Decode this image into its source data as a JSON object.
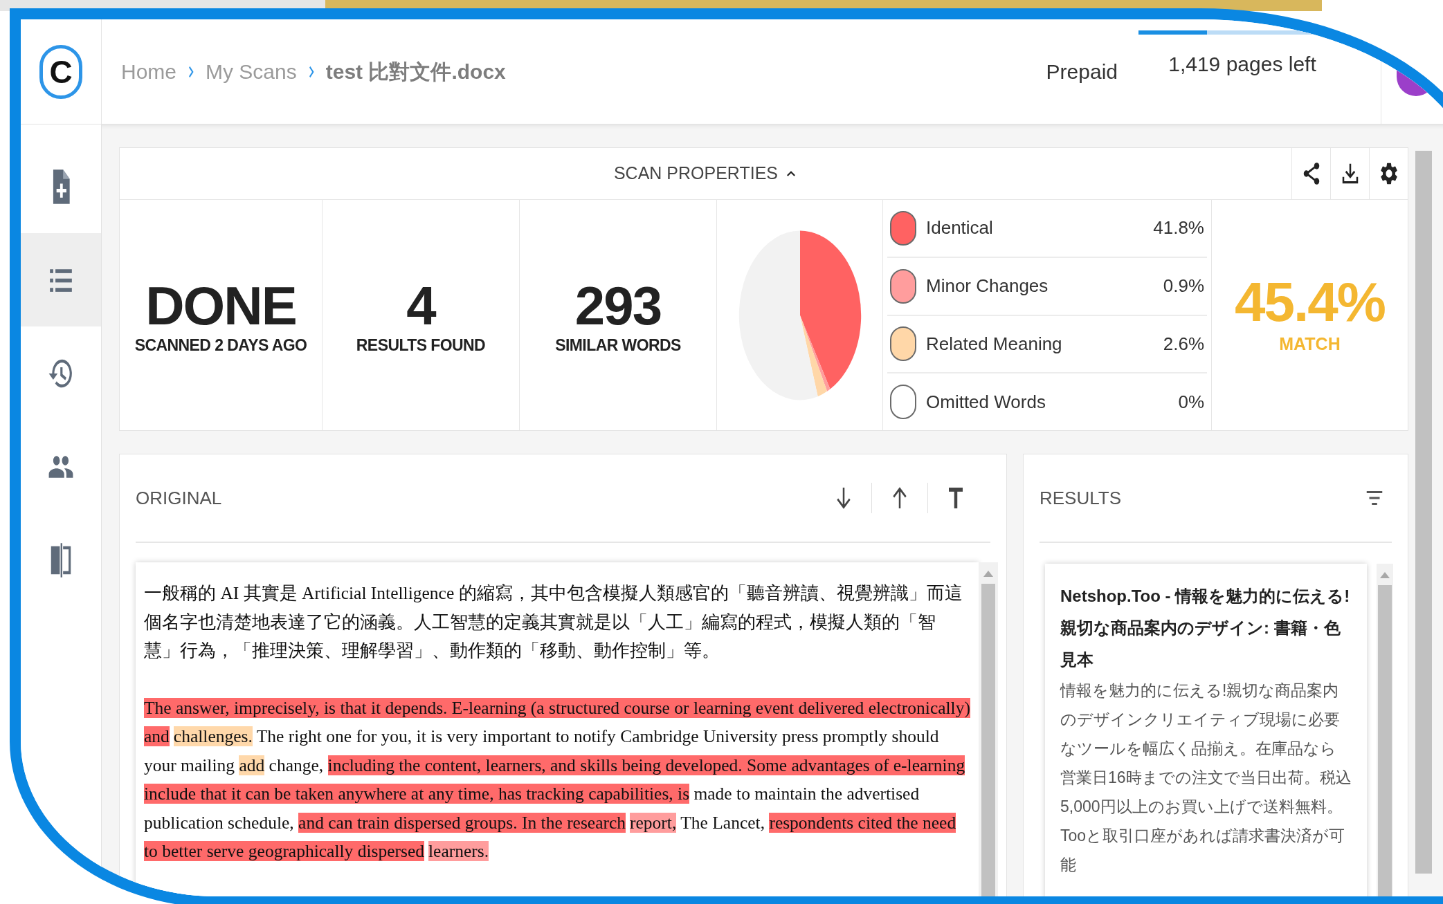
{
  "header": {
    "logo": "C",
    "breadcrumb": [
      {
        "label": "Home",
        "current": false
      },
      {
        "label": "My Scans",
        "current": false
      },
      {
        "label": "test 比對文件.docx",
        "current": true
      }
    ],
    "plan": "Prepaid",
    "pages_left": "1,419 pages left",
    "usage": {
      "level": 0.33
    }
  },
  "sidebar": {
    "items": [
      {
        "kind": "new-scan",
        "selected": false
      },
      {
        "kind": "list",
        "selected": true
      },
      {
        "kind": "history",
        "selected": false
      },
      {
        "kind": "users",
        "selected": false
      },
      {
        "kind": "compare",
        "selected": false
      }
    ]
  },
  "scan_properties": {
    "title": "SCAN PROPERTIES",
    "expanded": true,
    "actions": [
      {
        "kind": "share"
      },
      {
        "kind": "download"
      },
      {
        "kind": "settings"
      }
    ],
    "stats": [
      {
        "value": "DONE",
        "label": "SCANNED 2 DAYS AGO"
      },
      {
        "value": "4",
        "label": "RESULTS FOUND"
      },
      {
        "value": "293",
        "label": "SIMILAR WORDS"
      }
    ],
    "chart_data": {
      "type": "pie",
      "categories": [
        "Identical",
        "Minor Changes",
        "Related Meaning",
        "Omitted Words",
        null
      ],
      "values": [
        41.8,
        0.9,
        2.6,
        0,
        54.7
      ]
    },
    "legend": [
      {
        "percent": "41.8%",
        "color": "#ff6262"
      },
      {
        "percent": "0.9%",
        "color": "#ff9d9d"
      },
      {
        "percent": "2.6%",
        "color": "#ffd7a8"
      },
      {
        "percent": "0%",
        "color": "#ffffff"
      }
    ],
    "match": {
      "value": "45.4%",
      "label": "MATCH"
    }
  },
  "original": {
    "title": "ORIGINAL",
    "tools": [
      {
        "kind": "next"
      },
      {
        "kind": "previous"
      },
      {
        "kind": "text"
      }
    ],
    "paragraphs": [
      [
        {
          "text": "一般稱的 AI 其實是 Artificial Intelligence 的縮寫，其中包含模擬人類感官的「聽音辨讀、視覺辨識」而這個名字也清楚地表達了它的涵義。人工智慧的定義其實就是以「人工」編寫的程式，模擬人類的「智慧」行為，「推理決策、理解學習」、動作類的「移動、動作控制」等。",
          "kind": "none"
        }
      ],
      [
        {
          "text": "The answer, imprecisely, is that it depends. E-learning (a structured course or learning event delivered electronically) and",
          "kind": "identical"
        },
        {
          "text": "challenges.",
          "kind": "related"
        },
        {
          "text": " The right one for you, it is very important to notify Cambridge University press promptly should your mailing ",
          "kind": "none"
        },
        {
          "text": "add",
          "kind": "related"
        },
        {
          "text": " change, ",
          "kind": "none"
        },
        {
          "text": "including the content, learners, and skills being developed. Some advantages of e-learning include that it can be taken anywhere at any time, has tracking capabilities, is",
          "kind": "identical"
        },
        {
          "text": " made to maintain the advertised publication schedule, ",
          "kind": "none"
        },
        {
          "text": "and can train dispersed groups. In the research",
          "kind": "identical"
        },
        {
          "text": "report,",
          "kind": "minor"
        },
        {
          "text": " The Lancet, ",
          "kind": "none"
        },
        {
          "text": "respondents cited the need to better serve geographically dispersed",
          "kind": "identical"
        },
        {
          "text": "learners.",
          "kind": "minor"
        }
      ]
    ]
  },
  "results": {
    "title": "RESULTS",
    "items": [
      {
        "title": "Netshop.Too - 情報を魅力的に伝える! 親切な商品案内のデザイン: 書籍・色見本",
        "snippet": "情報を魅力的に伝える!親切な商品案内のデザインクリエイティブ現場に必要なツールを幅広く品揃え。在庫品なら営業日16時までの注文で当日出荷。税込5,000円以上のお買い上げで送料無料。Tooと取引口座があれば請求書決済が可能"
      }
    ]
  }
}
